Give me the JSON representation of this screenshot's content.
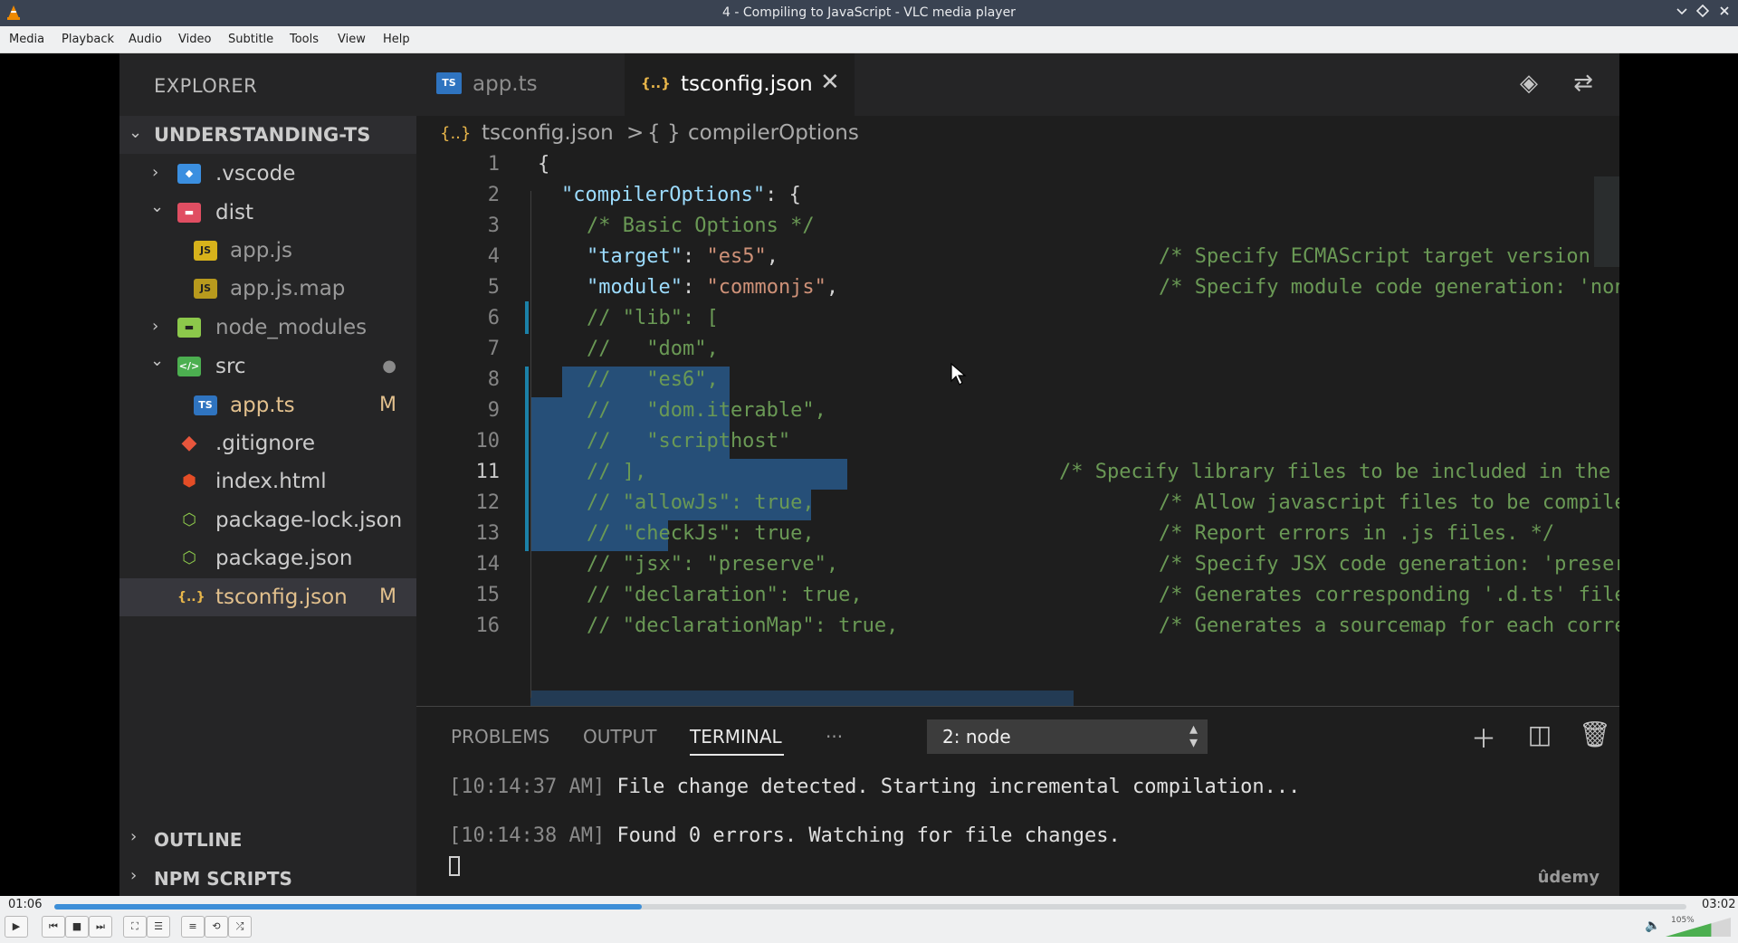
{
  "window": {
    "title": "4 - Compiling to JavaScript - VLC media player",
    "minimize_icon": "chevron-down-icon",
    "maximize_icon": "restore-icon",
    "close_icon": "close-icon"
  },
  "menu": [
    "Media",
    "Playback",
    "Audio",
    "Video",
    "Subtitle",
    "Tools",
    "View",
    "Help"
  ],
  "vscode": {
    "explorer_title": "EXPLORER",
    "project": "UNDERSTANDING-TS",
    "tree": [
      {
        "name": ".vscode",
        "icon": "folder-vscode-icon",
        "badge": ""
      },
      {
        "name": "dist",
        "icon": "folder-dist-icon",
        "badge": ""
      },
      {
        "name": "app.js",
        "icon": "js-file-icon",
        "badge": ""
      },
      {
        "name": "app.js.map",
        "icon": "js-map-file-icon",
        "badge": ""
      },
      {
        "name": "node_modules",
        "icon": "folder-node-icon",
        "badge": ""
      },
      {
        "name": "src",
        "icon": "folder-src-icon",
        "badge": "●"
      },
      {
        "name": "app.ts",
        "icon": "ts-file-icon",
        "badge": "M"
      },
      {
        "name": ".gitignore",
        "icon": "git-file-icon",
        "badge": ""
      },
      {
        "name": "index.html",
        "icon": "html-file-icon",
        "badge": ""
      },
      {
        "name": "package-lock.json",
        "icon": "npm-file-icon",
        "badge": ""
      },
      {
        "name": "package.json",
        "icon": "npm-file-icon",
        "badge": ""
      },
      {
        "name": "tsconfig.json",
        "icon": "json-file-icon",
        "badge": "M"
      }
    ],
    "outline": "OUTLINE",
    "npm_scripts": "NPM SCRIPTS",
    "tabs": [
      {
        "label": "app.ts",
        "icon": "ts-file-icon"
      },
      {
        "label": "tsconfig.json",
        "icon": "json-file-icon"
      }
    ],
    "breadcrumb": {
      "file": "tsconfig.json",
      "sep": ">",
      "symbol": "compilerOptions",
      "file_glyph": "{..}",
      "symbol_glyph": "{ }"
    },
    "line_numbers": [
      "1",
      "2",
      "3",
      "4",
      "5",
      "6",
      "7",
      "8",
      "9",
      "10",
      "11",
      "12",
      "13",
      "14",
      "15",
      "16"
    ],
    "code": {
      "l1": "{",
      "l2_key": "\"compilerOptions\"",
      "l2_rest": ": {",
      "l3": "/* Basic Options */",
      "l4_key": "\"target\"",
      "l4_val": "\"es5\"",
      "l4_com": "/* Specify ECMAScript target version: 'E",
      "l5_key": "\"module\"",
      "l5_val": "\"commonjs\"",
      "l5_com": "/* Specify module code generation: 'none",
      "l6": "// \"lib\": [",
      "l7": "//   \"dom\",",
      "l8": "//   \"es6\",",
      "l9": "//   \"dom.iterable\",",
      "l10": "//   \"scripthost\"",
      "l11": "// ],",
      "l11_com": "/* Specify library files to be included in the c",
      "l12": "// \"allowJs\": true,",
      "l12_com": "/* Allow javascript files to be compiled",
      "l13": "// \"checkJs\": true,",
      "l13_com": "/* Report errors in .js files. */",
      "l14": "// \"jsx\": \"preserve\",",
      "l14_com": "/* Specify JSX code generation: 'preserv",
      "l15": "// \"declaration\": true,",
      "l15_com": "/* Generates corresponding '.d.ts' file.",
      "l16": "// \"declarationMap\": true,",
      "l16_com": "/* Generates a sourcemap for each corres"
    },
    "panel": {
      "tabs": [
        "PROBLEMS",
        "OUTPUT",
        "TERMINAL",
        "···"
      ],
      "terminal_select": "2: node",
      "terminal_lines": [
        {
          "ts": "[10:14:37 AM]",
          "msg": "File change detected. Starting incremental compilation..."
        },
        {
          "ts": "[10:14:38 AM]",
          "msg": "Found 0 errors. Watching for file changes."
        }
      ]
    },
    "watermark": "ûdemy"
  },
  "player": {
    "elapsed": "01:06",
    "total": "03:02",
    "progress_fraction": 0.36,
    "volume_percent": "105%",
    "volume_fraction": 0.7
  },
  "colors": {
    "accent": "#3d8fd8",
    "selection": "#264f78"
  }
}
